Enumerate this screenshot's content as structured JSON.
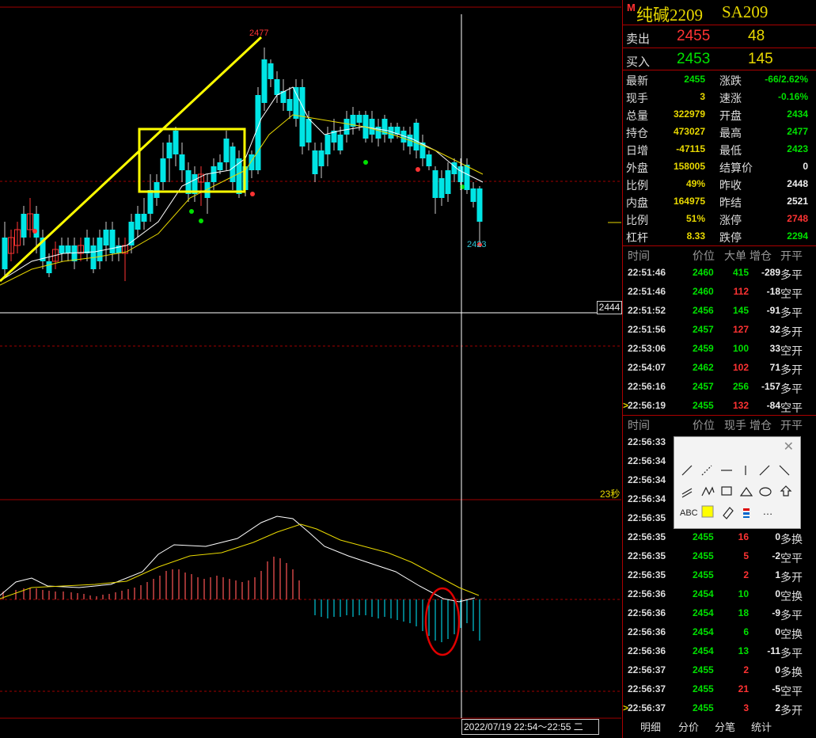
{
  "instrument": {
    "marker": "M",
    "name": "纯碱2209",
    "code": "SA209"
  },
  "quote": {
    "sell": {
      "label": "卖出",
      "price": "2455",
      "volume": "48"
    },
    "buy": {
      "label": "买入",
      "price": "2453",
      "volume": "145"
    }
  },
  "stats_left": [
    {
      "k": "最新",
      "v": "2455",
      "c": "g"
    },
    {
      "k": "现手",
      "v": "3",
      "c": "y"
    },
    {
      "k": "总量",
      "v": "322979",
      "c": "y"
    },
    {
      "k": "持仓",
      "v": "473027",
      "c": "y"
    },
    {
      "k": "日增",
      "v": "-47115",
      "c": "y"
    },
    {
      "k": "外盘",
      "v": "158005",
      "c": "y"
    },
    {
      "k": "比例",
      "v": "49%",
      "c": "y"
    },
    {
      "k": "内盘",
      "v": "164975",
      "c": "y"
    },
    {
      "k": "比例",
      "v": "51%",
      "c": "y"
    },
    {
      "k": "杠杆",
      "v": "8.33",
      "c": "y"
    }
  ],
  "stats_right": [
    {
      "k": "涨跌",
      "v": "-66/2.62%",
      "c": "g"
    },
    {
      "k": "速涨",
      "v": "-0.16%",
      "c": "g"
    },
    {
      "k": "开盘",
      "v": "2434",
      "c": "g"
    },
    {
      "k": "最高",
      "v": "2477",
      "c": "g"
    },
    {
      "k": "最低",
      "v": "2423",
      "c": "g"
    },
    {
      "k": "结算价",
      "v": "0",
      "c": "w"
    },
    {
      "k": "昨收",
      "v": "2448",
      "c": "w"
    },
    {
      "k": "昨结",
      "v": "2521",
      "c": "w"
    },
    {
      "k": "涨停",
      "v": "2748",
      "c": "r"
    },
    {
      "k": "跌停",
      "v": "2294",
      "c": "g"
    }
  ],
  "big_orders": {
    "headers": [
      "时间",
      "价位",
      "大单",
      "增仓",
      "开平"
    ],
    "rows": [
      {
        "t": "22:51:46",
        "p": "2460",
        "v": "415",
        "d": "-289",
        "k": "多平",
        "vc": "g",
        "pc": "g"
      },
      {
        "t": "22:51:46",
        "p": "2460",
        "v": "112",
        "d": "-18",
        "k": "空平",
        "vc": "r",
        "pc": "g"
      },
      {
        "t": "22:51:52",
        "p": "2456",
        "v": "145",
        "d": "-91",
        "k": "多平",
        "vc": "g",
        "pc": "g"
      },
      {
        "t": "22:51:56",
        "p": "2457",
        "v": "127",
        "d": "32",
        "k": "多开",
        "vc": "r",
        "pc": "g"
      },
      {
        "t": "22:53:06",
        "p": "2459",
        "v": "100",
        "d": "33",
        "k": "空开",
        "vc": "g",
        "pc": "g"
      },
      {
        "t": "22:54:07",
        "p": "2462",
        "v": "102",
        "d": "71",
        "k": "多开",
        "vc": "r",
        "pc": "g"
      },
      {
        "t": "22:56:16",
        "p": "2457",
        "v": "256",
        "d": "-157",
        "k": "多平",
        "vc": "g",
        "pc": "g"
      },
      {
        "t": "22:56:19",
        "p": "2455",
        "v": "132",
        "d": "-84",
        "k": "空平",
        "vc": "r",
        "pc": "g"
      }
    ]
  },
  "ticks": {
    "headers": [
      "时间",
      "价位",
      "现手",
      "增仓",
      "开平"
    ],
    "rows": [
      {
        "t": "22:56:33",
        "p": "",
        "v": "",
        "d": "",
        "k": "",
        "vc": "g",
        "pc": "g"
      },
      {
        "t": "22:56:34",
        "p": "",
        "v": "",
        "d": "",
        "k": "",
        "vc": "g",
        "pc": "g"
      },
      {
        "t": "22:56:34",
        "p": "",
        "v": "",
        "d": "",
        "k": "",
        "vc": "g",
        "pc": "g"
      },
      {
        "t": "22:56:34",
        "p": "",
        "v": "",
        "d": "",
        "k": "",
        "vc": "g",
        "pc": "g"
      },
      {
        "t": "22:56:35",
        "p": "",
        "v": "",
        "d": "",
        "k": "",
        "vc": "g",
        "pc": "g"
      },
      {
        "t": "22:56:35",
        "p": "2455",
        "v": "16",
        "d": "0",
        "k": "多换",
        "vc": "r",
        "pc": "g"
      },
      {
        "t": "22:56:35",
        "p": "2455",
        "v": "5",
        "d": "-2",
        "k": "空平",
        "vc": "r",
        "pc": "g"
      },
      {
        "t": "22:56:35",
        "p": "2455",
        "v": "2",
        "d": "1",
        "k": "多开",
        "vc": "r",
        "pc": "g"
      },
      {
        "t": "22:56:36",
        "p": "2454",
        "v": "10",
        "d": "0",
        "k": "空换",
        "vc": "g",
        "pc": "g"
      },
      {
        "t": "22:56:36",
        "p": "2454",
        "v": "18",
        "d": "-9",
        "k": "多平",
        "vc": "g",
        "pc": "g"
      },
      {
        "t": "22:56:36",
        "p": "2454",
        "v": "6",
        "d": "0",
        "k": "空换",
        "vc": "g",
        "pc": "g"
      },
      {
        "t": "22:56:36",
        "p": "2454",
        "v": "13",
        "d": "-11",
        "k": "多平",
        "vc": "g",
        "pc": "g"
      },
      {
        "t": "22:56:37",
        "p": "2455",
        "v": "2",
        "d": "0",
        "k": "多换",
        "vc": "r",
        "pc": "g"
      },
      {
        "t": "22:56:37",
        "p": "2455",
        "v": "21",
        "d": "-5",
        "k": "空平",
        "vc": "r",
        "pc": "g"
      },
      {
        "t": "22:56:37",
        "p": "2455",
        "v": "3",
        "d": "2",
        "k": "多开",
        "vc": "r",
        "pc": "g"
      }
    ]
  },
  "tabs": [
    "明细",
    "分价",
    "分笔",
    "统计"
  ],
  "chart": {
    "high_label": "2477",
    "low_label": "2423",
    "crosshair_price": "2444",
    "countdown": "23秒",
    "date_range": "2022/07/19 22:54～22:55 二"
  },
  "draw_tool": {
    "close": "✕",
    "text_tool": "ABC",
    "more": "…"
  },
  "colors": {
    "up": "#ff3333",
    "down": "#00e5e5",
    "yellow": "#e8d800",
    "grid": "#a00000"
  }
}
